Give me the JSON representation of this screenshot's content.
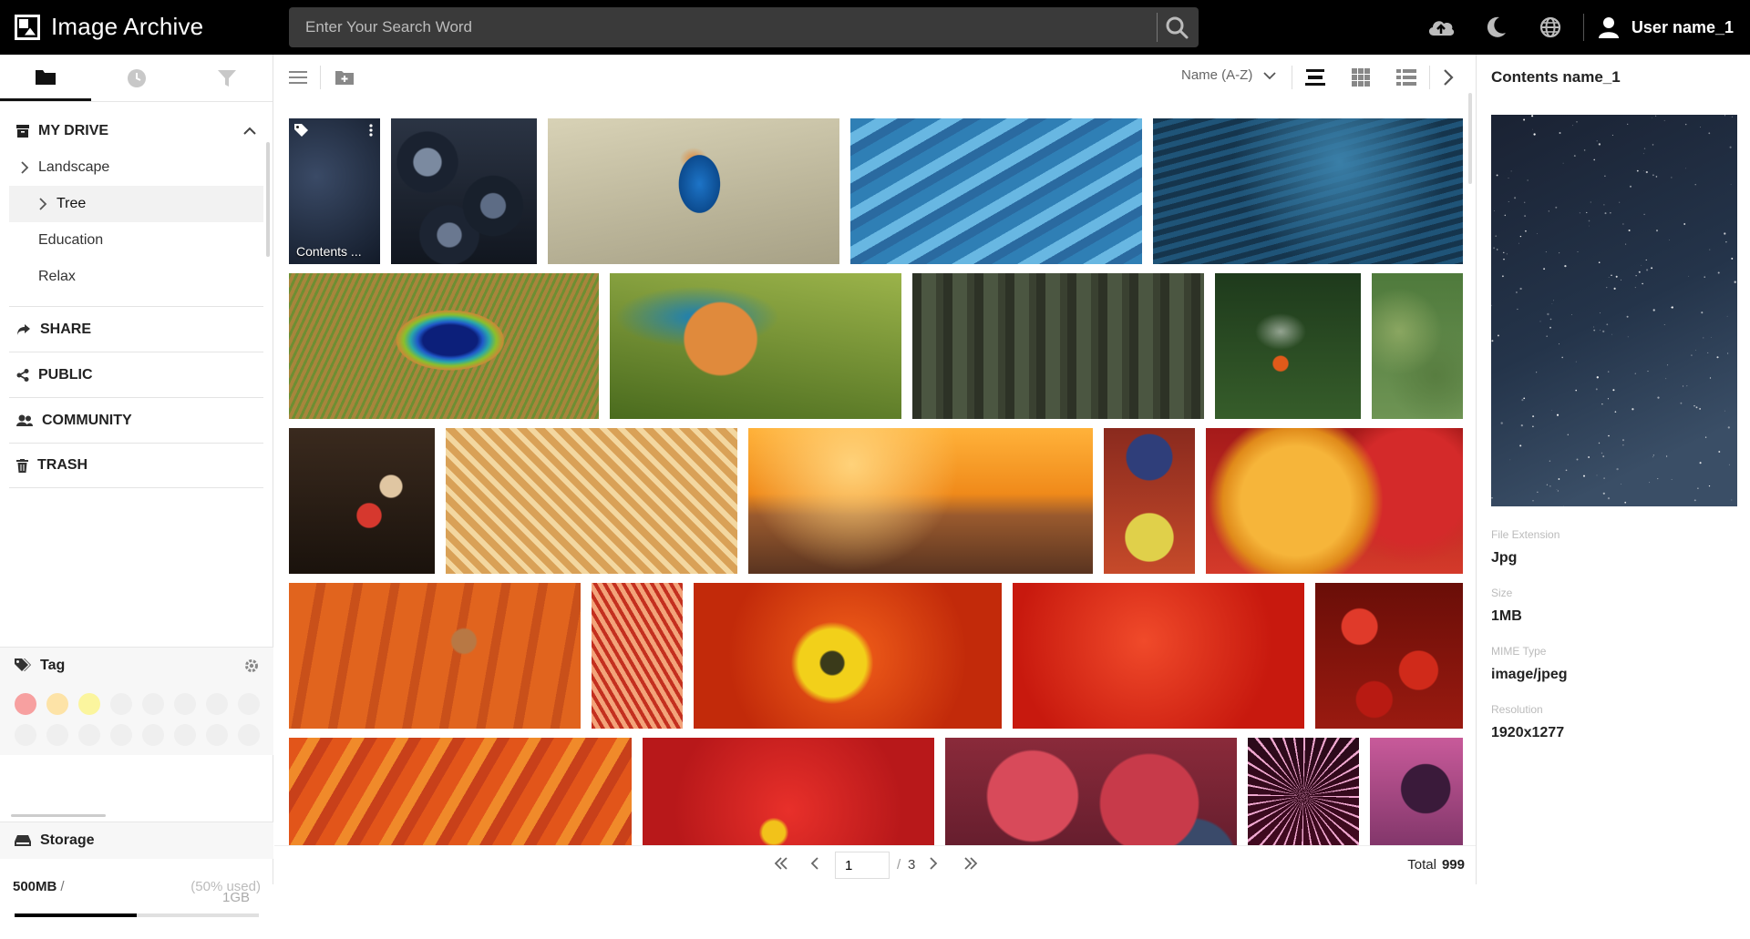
{
  "app": {
    "title": "Image Archive"
  },
  "search": {
    "placeholder": "Enter Your Search Word"
  },
  "topbar": {
    "icons": [
      "upload-cloud-icon",
      "moon-icon",
      "globe-icon",
      "user-icon"
    ],
    "user_name": "User name_1"
  },
  "sidebar": {
    "tabs": [
      "folder-icon",
      "clock-icon",
      "filter-icon"
    ],
    "active_tab": 0,
    "drive": {
      "label": "MY DRIVE"
    },
    "tree": [
      {
        "label": "Landscape",
        "expandable": true
      },
      {
        "label": "Tree",
        "expandable": true,
        "selected": true
      },
      {
        "label": "Education",
        "expandable": false
      },
      {
        "label": "Relax",
        "expandable": false
      }
    ],
    "sections": [
      {
        "label": "SHARE",
        "icon": "share-icon"
      },
      {
        "label": "PUBLIC",
        "icon": "network-share-icon"
      },
      {
        "label": "COMMUNITY",
        "icon": "users-icon"
      },
      {
        "label": "TRASH",
        "icon": "trash-icon"
      }
    ],
    "tag": {
      "label": "Tag",
      "colors": [
        "#f7a0a0",
        "#fde3a7",
        "#fbf59e",
        "#efefef",
        "#efefef",
        "#efefef",
        "#efefef",
        "#efefef",
        "#efefef",
        "#efefef",
        "#efefef",
        "#efefef",
        "#efefef",
        "#efefef",
        "#efefef",
        "#efefef"
      ]
    },
    "storage": {
      "label": "Storage",
      "used": "500MB",
      "separator": "/",
      "total": "1GB",
      "percent_text": "(50% used)",
      "fraction": 0.5
    }
  },
  "toolbar": {
    "sort_label": "Name (A-Z)"
  },
  "grid": {
    "selected_label": "Contents ...",
    "rows": [
      [
        {
          "w": 100,
          "theme": "stars"
        },
        {
          "w": 160,
          "theme": "blueberries"
        },
        {
          "w": 320,
          "theme": "kingfisher-branch"
        },
        {
          "w": 320,
          "theme": "ice"
        },
        {
          "w": 341,
          "theme": "water"
        }
      ],
      [
        {
          "w": 340,
          "theme": "peacock"
        },
        {
          "w": 320,
          "theme": "kingfisher-head"
        },
        {
          "w": 320,
          "theme": "forest"
        },
        {
          "w": 160,
          "theme": "butterfly"
        },
        {
          "w": 100,
          "theme": "aerial"
        }
      ],
      [
        {
          "w": 160,
          "theme": "dancers"
        },
        {
          "w": 320,
          "theme": "pie"
        },
        {
          "w": 378,
          "theme": "pier-sunset"
        },
        {
          "w": 100,
          "theme": "jam"
        },
        {
          "w": 282,
          "theme": "raspberry-yellow"
        }
      ],
      [
        {
          "w": 320,
          "theme": "pumpkin"
        },
        {
          "w": 100,
          "theme": "lantern"
        },
        {
          "w": 338,
          "theme": "poppy"
        },
        {
          "w": 320,
          "theme": "petal"
        },
        {
          "w": 162,
          "theme": "cherries"
        }
      ],
      [
        {
          "w": 376,
          "theme": "fabric"
        },
        {
          "w": 320,
          "theme": "hibiscus"
        },
        {
          "w": 320,
          "theme": "raspberries"
        },
        {
          "w": 122,
          "theme": "fireworks"
        },
        {
          "w": 102,
          "theme": "purple-tree"
        }
      ]
    ]
  },
  "pager": {
    "current": "1",
    "separator": "/",
    "pages": "3",
    "total_label": "Total",
    "total_value": "999"
  },
  "details": {
    "title": "Contents name_1",
    "fields": [
      {
        "key": "File Extension",
        "value": "Jpg"
      },
      {
        "key": "Size",
        "value": "1MB"
      },
      {
        "key": "MIME Type",
        "value": "image/jpeg"
      },
      {
        "key": "Resolution",
        "value": "1920x1277"
      }
    ]
  }
}
